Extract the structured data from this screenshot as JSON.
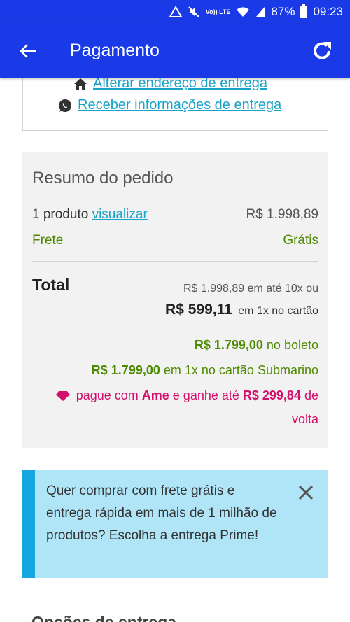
{
  "status_bar": {
    "network_label": "Vo)) LTE",
    "battery": "87%",
    "time": "09:23"
  },
  "app_bar": {
    "title": "Pagamento"
  },
  "delivery": {
    "change_address": "Alterar endereço de entrega",
    "receive_info": "Receber informações de entrega"
  },
  "summary": {
    "heading": "Resumo do pedido",
    "products_label": "1 produto",
    "view_link": "visualizar",
    "products_price": "R$ 1.998,89",
    "shipping_label": "Frete",
    "shipping_value": "Grátis",
    "total_label": "Total",
    "installments_line": "R$ 1.998,89 em até 10x ou",
    "card_price": "R$ 599,11",
    "card_suffix": "em 1x no cartão",
    "boleto_price": "R$ 1.799,00",
    "boleto_suffix": "no boleto",
    "submarino_price": "R$ 1.799,00",
    "submarino_suffix": "em 1x no cartão Submarino",
    "ame_prefix": "pague com",
    "ame_brand": "Ame",
    "ame_middle": "e ganhe até",
    "ame_cashback": "R$ 299,84",
    "ame_suffix": "de",
    "ame_last": "volta"
  },
  "prime_banner": {
    "message": "Quer comprar com frete grátis e entrega rápida em mais de 1 milhão de produtos? Escolha a entrega Prime!"
  },
  "next_section": {
    "heading": "Opções de entrega"
  },
  "colors": {
    "app_bar": "#1a3ae8",
    "link": "#1aa3c9",
    "green": "#4d8a00",
    "ame": "#d4106d",
    "prime_bg": "#b0e5f7",
    "prime_stripe": "#15a6e0"
  }
}
